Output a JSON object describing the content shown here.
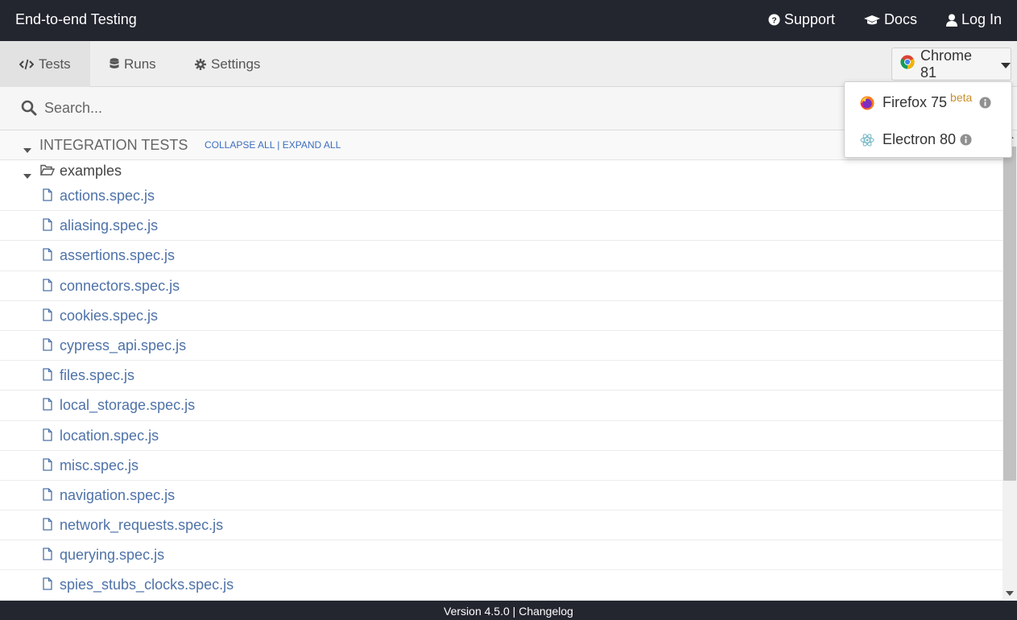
{
  "header": {
    "title": "End-to-end Testing",
    "nav": [
      {
        "label": "Support",
        "icon": "question-circle-icon"
      },
      {
        "label": "Docs",
        "icon": "graduation-cap-icon"
      },
      {
        "label": "Log In",
        "icon": "user-icon"
      }
    ]
  },
  "tabs": [
    {
      "label": "Tests",
      "icon": "code-icon",
      "active": true
    },
    {
      "label": "Runs",
      "icon": "database-icon",
      "active": false
    },
    {
      "label": "Settings",
      "icon": "gear-icon",
      "active": false
    }
  ],
  "browser": {
    "selected": "Chrome 81",
    "options": [
      {
        "label": "Firefox 75",
        "badge": "beta",
        "icon": "firefox-icon"
      },
      {
        "label": "Electron 80",
        "badge": "",
        "icon": "electron-icon"
      }
    ]
  },
  "search": {
    "placeholder": "Search...",
    "value": ""
  },
  "integration": {
    "title": "INTEGRATION TESTS",
    "collapse_label": "COLLAPSE ALL",
    "separator": "|",
    "expand_label": "EXPAND ALL",
    "folder": "examples",
    "files": [
      "actions.spec.js",
      "aliasing.spec.js",
      "assertions.spec.js",
      "connectors.spec.js",
      "cookies.spec.js",
      "cypress_api.spec.js",
      "files.spec.js",
      "local_storage.spec.js",
      "location.spec.js",
      "misc.spec.js",
      "navigation.spec.js",
      "network_requests.spec.js",
      "querying.spec.js",
      "spies_stubs_clocks.spec.js"
    ]
  },
  "footer": {
    "version": "Version 4.5.0",
    "separator": "|",
    "changelog": "Changelog"
  },
  "colors": {
    "header_bg": "#23252f",
    "link": "#4e72a8",
    "beta": "#c98e2a"
  }
}
